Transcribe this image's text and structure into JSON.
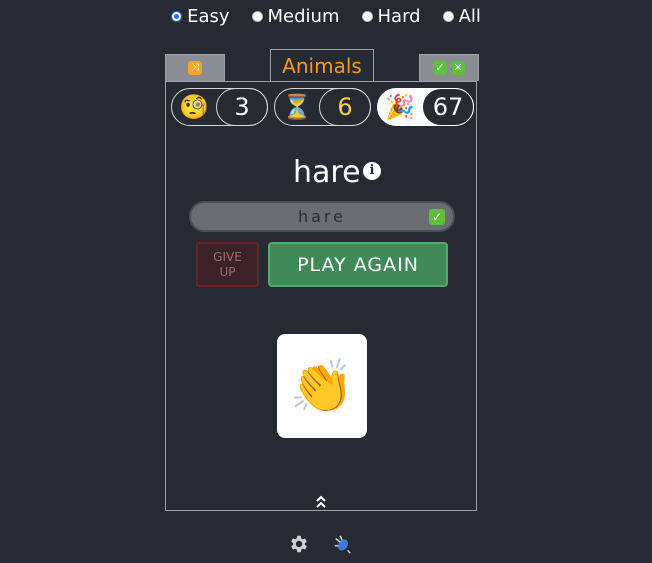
{
  "difficulty": {
    "options": [
      {
        "label": "Easy",
        "checked": true
      },
      {
        "label": "Medium",
        "checked": false
      },
      {
        "label": "Hard",
        "checked": false
      },
      {
        "label": "All",
        "checked": false
      }
    ]
  },
  "tabs": {
    "shuffle_icon": "shuffle-icon",
    "category": "Animals",
    "check_icon": "check-icon",
    "x_icon": "cross-icon"
  },
  "stats": [
    {
      "icon": "monocle-face-icon",
      "emoji": "🧐",
      "value": "3"
    },
    {
      "icon": "hourglass-icon",
      "emoji": "⏳",
      "value": "6"
    },
    {
      "icon": "party-popper-icon",
      "emoji": "🎉",
      "value": "67"
    }
  ],
  "puzzle": {
    "word": "hare",
    "answer": "hare"
  },
  "buttons": {
    "give_up": "GIVE UP",
    "play_again": "PLAY AGAIN"
  },
  "result": {
    "emoji": "👏",
    "icon": "clapping-hands-icon"
  },
  "colors": {
    "background": "#262a33",
    "category": "#f59a23",
    "play_again": "#3f8a58",
    "give_up": "#3a2228",
    "hourglass_value": "#f4d03f"
  }
}
